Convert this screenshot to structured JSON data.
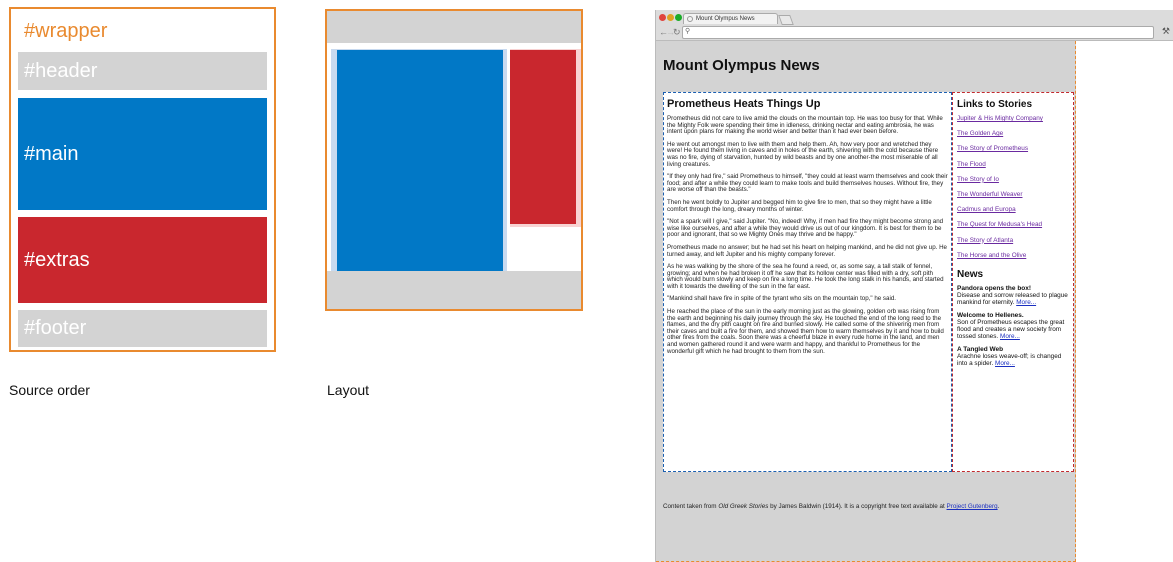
{
  "source_order": {
    "title": "#wrapper",
    "blocks": [
      "#header",
      "#main",
      "#extras",
      "#footer"
    ],
    "caption": "Source order"
  },
  "layout_caption": "Layout",
  "colors": {
    "orange": "#e98a2f",
    "gray": "#d3d3d3",
    "blue": "#0178c6",
    "red": "#c9272e",
    "light_blue": "#c8daf0",
    "light_red": "#f8d3d3"
  },
  "browser": {
    "tab_title": "Mount Olympus News",
    "header": "Mount Olympus News",
    "main": {
      "title": "Prometheus Heats Things Up",
      "paragraphs": [
        "Prometheus did not care to live amid the clouds on the mountain top. He was too busy for that. While the Mighty Folk were spending their time in idleness, drinking nectar and eating ambrosia, he was intent upon plans for making the world wiser and better than it had ever been before.",
        "He went out amongst men to live with them and help them. Ah, how very poor and wretched they were! He found them living in caves and in holes of the earth, shivering with the cold because there was no fire, dying of starvation, hunted by wild beasts and by one another-the most miserable of all living creatures.",
        "\"If they only had fire,\" said Prometheus to himself, \"they could at least warm themselves and cook their food; and after a while they could learn to make tools and build themselves houses. Without fire, they are worse off than the beasts.\"",
        "Then he went boldly to Jupiter and begged him to give fire to men, that so they might have a little comfort through the long, dreary months of winter.",
        "\"Not a spark will I give,\" said Jupiter. \"No, indeed! Why, if men had fire they might become strong and wise like ourselves, and after a while they would drive us out of our kingdom. It is best for them to be poor and ignorant, that so we Mighty Ones may thrive and be happy.\"",
        "Prometheus made no answer; but he had set his heart on helping mankind, and he did not give up. He turned away, and left Jupiter and his mighty company forever.",
        "As he was walking by the shore of the sea he found a reed, or, as some say, a tall stalk of fennel, growing; and when he had broken it off he saw that its hollow center was filled with a dry, soft pith which would burn slowly and keep on fire a long time. He took the long stalk in his hands, and started with it towards the dwelling of the sun in the far east.",
        "\"Mankind shall have fire in spite of the tyrant who sits on the mountain top,\" he said.",
        "He reached the place of the sun in the early morning just as the glowing, golden orb was rising from the earth and beginning his daily journey through the sky. He touched the end of the long reed to the flames, and the dry pith caught on fire and burned slowly. He called some of the shivering men from their caves and built a fire for them, and showed them how to warm themselves by it and how to build other fires from the coals. Soon there was a cheerful blaze in every rude home in the land, and men and women gathered round it and were warm and happy, and thankful to Prometheus for the wonderful gift which he had brought to them from the sun."
      ]
    },
    "extras": {
      "links_title": "Links to Stories",
      "links": [
        "Jupiter & His Mighty Company",
        "The Golden Age",
        "The Story of Prometheus",
        "The Flood",
        "The Story of Io",
        "The Wonderful Weaver",
        "Cadmus and Europa",
        "The Quest for Medusa's Head",
        "The Story of Atlanta",
        "The Horse and the Olive"
      ],
      "news_title": "News",
      "news": [
        {
          "headline": "Pandora opens the box!",
          "text": "Disease and sorrow released to plague mankind for eternity.",
          "more": "More..."
        },
        {
          "headline": "Welcome to Hellenes.",
          "text": "Son of Prometheus escapes the great flood and creates a new society from tossed stones.",
          "more": "More..."
        },
        {
          "headline": "A Tangled Web",
          "text": "Arachne loses weave-off; is changed into a spider.",
          "more": "More..."
        }
      ]
    },
    "footer": {
      "prefix": "Content taken from ",
      "book": "Old Greek Stories",
      "middle": " by James Baldwin (1914). It is a copyright free text available at ",
      "link": "Project Gutenberg",
      "suffix": "."
    }
  }
}
